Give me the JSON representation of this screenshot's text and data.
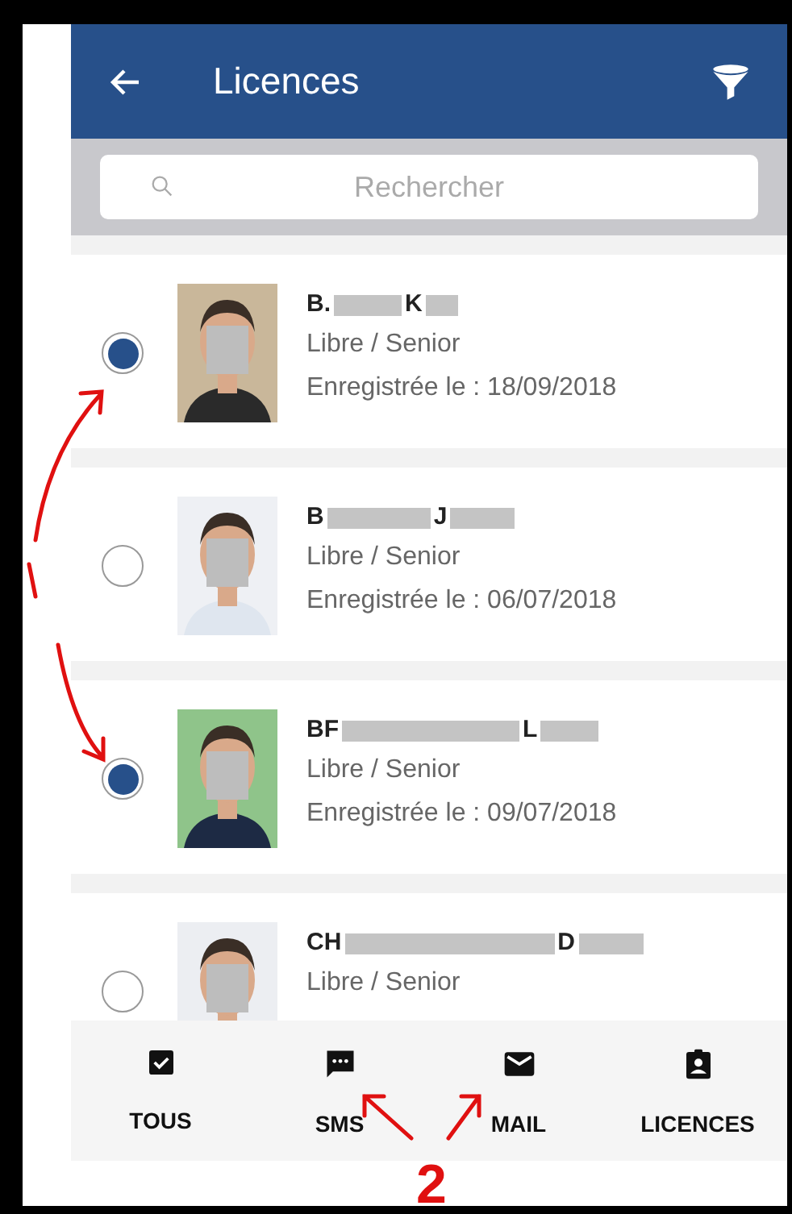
{
  "header": {
    "title": "Licences"
  },
  "search": {
    "placeholder": "Rechercher"
  },
  "licences": [
    {
      "name_visible": [
        "B.",
        "K"
      ],
      "category": "Libre / Senior",
      "date": "Enregistrée le : 18/09/2018",
      "selected": true
    },
    {
      "name_visible": [
        "B",
        "J"
      ],
      "category": "Libre / Senior",
      "date": "Enregistrée le : 06/07/2018",
      "selected": false
    },
    {
      "name_visible": [
        "BF",
        "L"
      ],
      "category": "Libre / Senior",
      "date": "Enregistrée le : 09/07/2018",
      "selected": true
    },
    {
      "name_visible": [
        "CH",
        "D"
      ],
      "category": "Libre / Senior",
      "selected": false
    }
  ],
  "bottom_bar": [
    {
      "kind": "check",
      "label": "TOUS"
    },
    {
      "kind": "sms",
      "label": "SMS"
    },
    {
      "kind": "mail",
      "label": "MAIL"
    },
    {
      "kind": "badge",
      "label": "LICENCES"
    }
  ],
  "annotation": {
    "label": "2"
  }
}
